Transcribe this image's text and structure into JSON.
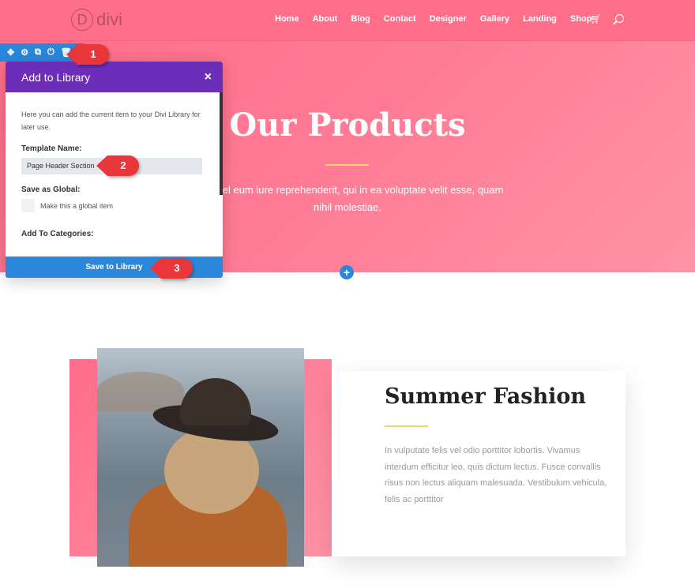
{
  "header": {
    "logo": "divi",
    "logo_letter": "D",
    "nav": [
      "Home",
      "About",
      "Blog",
      "Contact",
      "Designer",
      "Gallery",
      "Landing",
      "Shop"
    ],
    "cart_icon": "cart-icon",
    "search_icon": "search-icon"
  },
  "hero": {
    "title": "Our Products",
    "text": "utem vel eum iure reprehenderit, qui in ea voluptate velit esse, quam nihil molestiae.",
    "accent": "#f2d46f"
  },
  "toolbar": {
    "icons": [
      "move-icon",
      "gear-icon",
      "duplicate-icon",
      "save-icon",
      "trash-icon"
    ],
    "color": "#2b87da"
  },
  "modal": {
    "title": "Add to Library",
    "close": "×",
    "description": "Here you can add the current item to your Divi Library for later use.",
    "template_label": "Template Name:",
    "template_value": "Page Header Section",
    "global_label": "Save as Global:",
    "global_checkbox": "Make this a global item",
    "categories_label": "Add To Categories:",
    "save_button": "Save to Library",
    "header_color": "#6c2eb9"
  },
  "callouts": [
    "1",
    "2",
    "3"
  ],
  "feature": {
    "title": "Summer Fashion",
    "text": "In vulputate felis vel odio porttitor lobortis. Vivamus interdum efficitur leo, quis dictum lectus. Fusce convallis risus non lectus aliquam malesuada. Vestibulum vehicula, felis ac porttitor"
  }
}
